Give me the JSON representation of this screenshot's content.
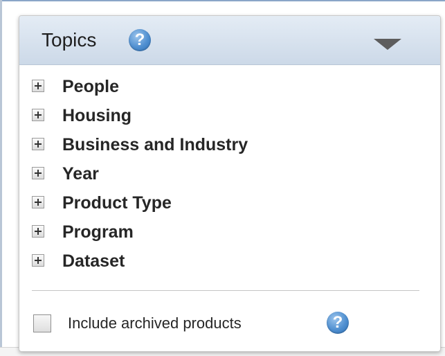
{
  "header": {
    "title": "Topics",
    "help_glyph": "?"
  },
  "topics": [
    {
      "label": "People",
      "icon": "plus-expand-icon"
    },
    {
      "label": "Housing",
      "icon": "plus-expand-icon"
    },
    {
      "label": "Business and Industry",
      "icon": "plus-expand-icon"
    },
    {
      "label": "Year",
      "icon": "plus-expand-icon"
    },
    {
      "label": "Product Type",
      "icon": "plus-expand-icon"
    },
    {
      "label": "Program",
      "icon": "plus-expand-icon"
    },
    {
      "label": "Dataset",
      "icon": "plus-expand-icon"
    }
  ],
  "archive": {
    "label": "Include archived products",
    "checked": false,
    "help_glyph": "?"
  },
  "colors": {
    "header_gradient_top": "#e4ecf5",
    "header_gradient_bottom": "#ccd9e8",
    "help_icon_blue": "#4f8fd0",
    "text": "#262626"
  }
}
